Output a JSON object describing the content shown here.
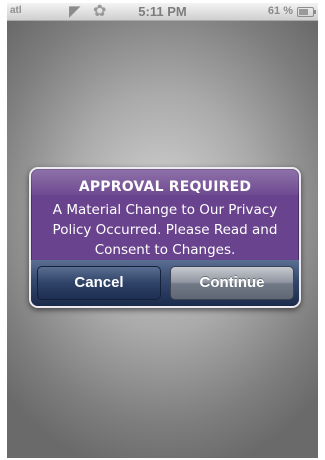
{
  "status_bar": {
    "carrier": "atl",
    "time": "5:11 PM",
    "battery_percent": "61 %",
    "battery_level": 0.61,
    "icons": [
      "signal-icon",
      "wifi-icon",
      "activity-icon",
      "battery-icon"
    ]
  },
  "alert": {
    "title": "APPROVAL REQUIRED",
    "message": "A Material Change to Our Privacy Policy Occurred. Please Read and Consent to Changes.",
    "cancel_label": "Cancel",
    "continue_label": "Continue",
    "accent_color": "#69438d",
    "button_bar_color": "#2b3d60"
  }
}
